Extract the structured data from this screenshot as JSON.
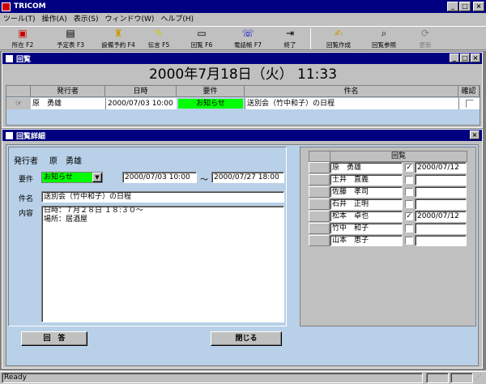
{
  "app": {
    "title": "TRICOM"
  },
  "menu": [
    "ツール(T)",
    "操作(A)",
    "表示(S)",
    "ウィンドウ(W)",
    "ヘルプ(H)"
  ],
  "toolbar": [
    {
      "label": "所在 F2",
      "icon": "location-icon"
    },
    {
      "label": "予定表 F3",
      "icon": "schedule-icon"
    },
    {
      "label": "設備予約 F4",
      "icon": "facility-icon"
    },
    {
      "label": "伝言 F5",
      "icon": "message-icon"
    },
    {
      "label": "回覧 F6",
      "icon": "circular-icon"
    },
    {
      "label": "電話帳 F7",
      "icon": "phonebook-icon"
    },
    {
      "label": "終了",
      "icon": "exit-icon"
    },
    {
      "label": "回覧作成",
      "icon": "create-circular-icon"
    },
    {
      "label": "回覧参照",
      "icon": "view-circular-icon"
    },
    {
      "label": "更新",
      "icon": "refresh-icon"
    }
  ],
  "list_window": {
    "title": "回覧",
    "date_header": "2000年7月18日（火）  11:33",
    "columns": [
      "発行者",
      "日時",
      "要件",
      "件名",
      "確認"
    ],
    "row": {
      "sender": "原　勇雄",
      "datetime": "2000/07/03 10:00",
      "type": "お知らせ",
      "subject": "送別会（竹中和子）の日程"
    }
  },
  "detail_window": {
    "title": "回覧詳細",
    "sender_label": "発行者",
    "sender_value": "原　勇雄",
    "type_label": "要件",
    "type_value": "お知らせ",
    "date_from": "2000/07/03 10:00",
    "tilde": "～",
    "date_to": "2000/07/27 18:00",
    "subject_label": "件名",
    "subject_value": "送別会（竹中和子）の日程",
    "content_label": "内容",
    "content_line1": "日時：７月２８日 １８:３０～",
    "content_line2": "場所：居酒屋",
    "circulation_header": "回覧",
    "recipients": [
      {
        "name": "原　勇雄",
        "checked": true,
        "date": "2000/07/12"
      },
      {
        "name": "土井　直義",
        "checked": false,
        "date": ""
      },
      {
        "name": "佐藤　孝司",
        "checked": false,
        "date": ""
      },
      {
        "name": "石井　正明",
        "checked": false,
        "date": ""
      },
      {
        "name": "松本　卓也",
        "checked": true,
        "date": "2000/07/12"
      },
      {
        "name": "竹中　和子",
        "checked": false,
        "date": ""
      },
      {
        "name": "山本　恵子",
        "checked": false,
        "date": ""
      }
    ],
    "reply_button": "回　答",
    "close_button": "閉じる"
  },
  "status": {
    "text": "Ready"
  },
  "colors": {
    "titlebar": "#000080",
    "panel": "#b8d0e8",
    "highlight": "#00ff00"
  }
}
